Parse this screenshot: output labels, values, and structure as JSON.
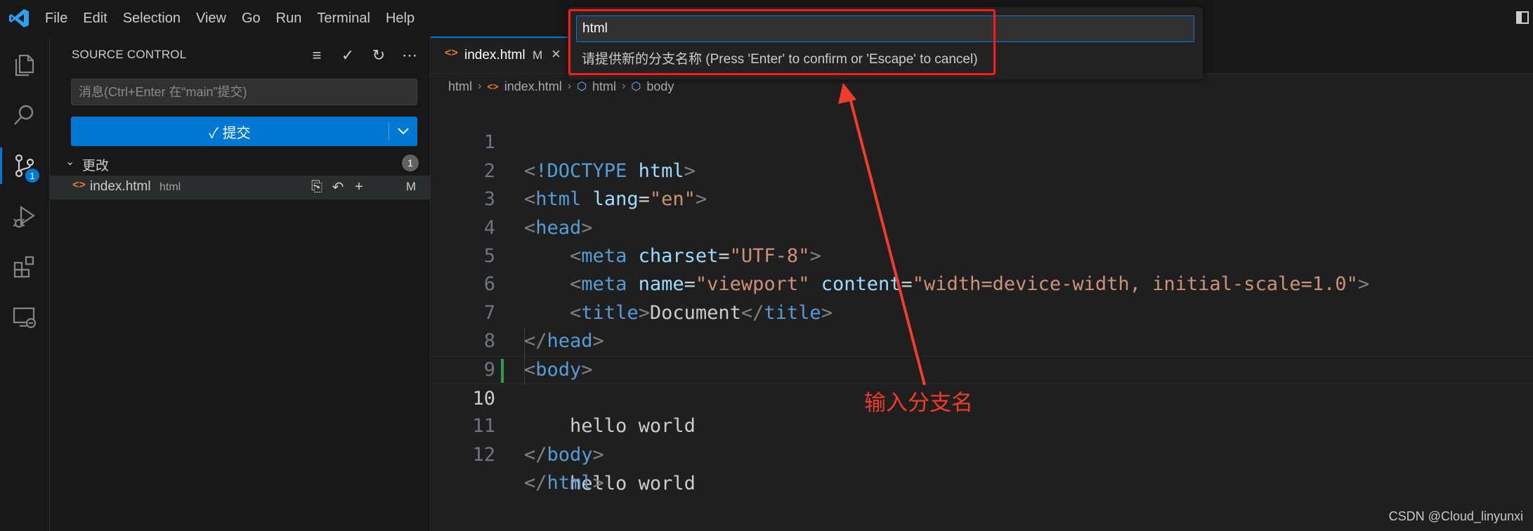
{
  "menu": [
    "File",
    "Edit",
    "Selection",
    "View",
    "Go",
    "Run",
    "Terminal",
    "Help"
  ],
  "activity_bar": {
    "items": [
      {
        "name": "explorer-icon"
      },
      {
        "name": "search-icon"
      },
      {
        "name": "source-control-icon",
        "badge": "1",
        "active": true
      },
      {
        "name": "run-debug-icon"
      },
      {
        "name": "extensions-icon"
      },
      {
        "name": "remote-explorer-icon"
      }
    ]
  },
  "sidebar": {
    "title": "SOURCE CONTROL",
    "commit_placeholder": "消息(Ctrl+Enter 在“main”提交)",
    "commit_button": "✓ 提交",
    "changes_label": "更改",
    "changes_count": "1",
    "file": {
      "name": "index.html",
      "dir": "html",
      "status": "M"
    }
  },
  "editor": {
    "tab": {
      "name": "index.html",
      "status": "M"
    },
    "breadcrumb": [
      "html",
      "index.html",
      "html",
      "body"
    ],
    "line_numbers": [
      "1",
      "2",
      "3",
      "4",
      "5",
      "6",
      "7",
      "8",
      "9",
      "10",
      "11",
      "12"
    ],
    "current_line": "10",
    "code": {
      "l1_kw": "!DOCTYPE",
      "l1_val": "html",
      "l2_tag": "html",
      "l2_attr": "lang",
      "l2_val": "\"en\"",
      "l3_tag": "head",
      "l4_tag": "meta",
      "l4_attr": "charset",
      "l4_val": "\"UTF-8\"",
      "l5_tag": "meta",
      "l5_attr1": "name",
      "l5_val1": "\"viewport\"",
      "l5_attr2": "content",
      "l5_val2": "\"width=device-width, initial-scale=1.0\"",
      "l6_tag": "title",
      "l6_text": "Document",
      "l7_tag": "head",
      "l8_tag": "body",
      "l9_text": "hello world",
      "l10_text": "hello world",
      "l11_tag": "body",
      "l12_tag": "html"
    }
  },
  "quick_input": {
    "value": "html",
    "message": "请提供新的分支名称 (Press 'Enter' to confirm or 'Escape' to cancel)"
  },
  "annotation": {
    "text": "输入分支名",
    "color": "#f03c28"
  },
  "watermark": "CSDN @Cloud_linyunxi",
  "colors": {
    "accent": "#0078d4",
    "annotation_red": "#ff1a1a"
  }
}
